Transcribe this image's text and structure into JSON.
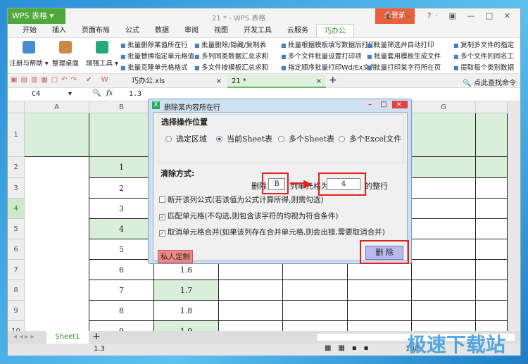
{
  "app": {
    "logo": "WPS 表格",
    "title": "21 * - WPS 表格",
    "login": "未登录",
    "controls": "◐ ▷· ?· ▣ — □ ✕"
  },
  "menus": [
    "开始",
    "插入",
    "页面布局",
    "公式",
    "数据",
    "审阅",
    "视图",
    "开发工具",
    "云服务",
    "巧办公"
  ],
  "active_menu": "巧办公",
  "ribbon": {
    "big": [
      "注册与帮助 ▾",
      "整理桌面",
      "增强工具 ▾"
    ],
    "cols": [
      [
        "批量删除某值所在行",
        "批量替换指定单元格值",
        "批量克隆单元格格式"
      ],
      [
        "批量删除/隐藏/复制表",
        "多列同类数据汇总求和",
        "多文件按模板汇总求和"
      ],
      [
        "批量根据模板填写数据后打印",
        "多个文件批量设置打印项",
        "指定顺序批量打印Wd/Ex文件"
      ],
      [
        "批量筛选并自动打印",
        "批量套用模板生成文件",
        "批量打印某字符所在页"
      ],
      [
        "复制多文件的指定",
        "多个文件的同名工",
        "提取每个类别数据"
      ]
    ]
  },
  "tabs": [
    {
      "label": "巧办公.xls"
    },
    {
      "label": "21 *"
    }
  ],
  "search_cmd": "点此查找命令",
  "formula": {
    "cell_ref": "C4",
    "fx": "fx",
    "value": "1.3"
  },
  "columns": [
    "A",
    "B",
    "C",
    "D",
    "E",
    "F",
    "G",
    ""
  ],
  "rows": [
    "1",
    "2",
    "3",
    "4",
    "5",
    "6",
    "7",
    "8",
    "9",
    "10"
  ],
  "b_values": [
    "",
    "1",
    "2",
    "3",
    "4",
    "5",
    "6",
    "7",
    "8",
    "9"
  ],
  "c_values": [
    "",
    "",
    "",
    "",
    "",
    "",
    "1.6",
    "1.7",
    "1.8",
    "1.9"
  ],
  "sheet": "Sheet1",
  "status_value": "1.3",
  "zoom": "100",
  "watermark": "极速下载站",
  "dialog": {
    "title": "删除某内容所在行",
    "group1": "选择操作位置",
    "options": [
      "选定区域",
      "当前Sheet表",
      "多个Sheet表",
      "多个Excel文件"
    ],
    "selected": "当前Sheet表",
    "group2": "清除方式:",
    "del_prefix": "删除",
    "col_value": "B",
    "mid": "列单元格为",
    "cell_value": "4",
    "suffix": "的整行",
    "checks": [
      {
        "label": "断开该列公式(若该值为公式计算所得,则需勾选)",
        "checked": false
      },
      {
        "label": "匹配单元格(不勾选,则包含该字符的均视为符合条件)",
        "checked": true
      },
      {
        "label": "取消单元格合并(如果该列存在合并单元格,则会出错,需要取消合并)",
        "checked": true
      }
    ],
    "custom": "私人定制",
    "delete": "删  除"
  },
  "colors": {
    "accent": "#4ea83b",
    "highlight": "#d9efd9",
    "annotation": "#e02020"
  }
}
